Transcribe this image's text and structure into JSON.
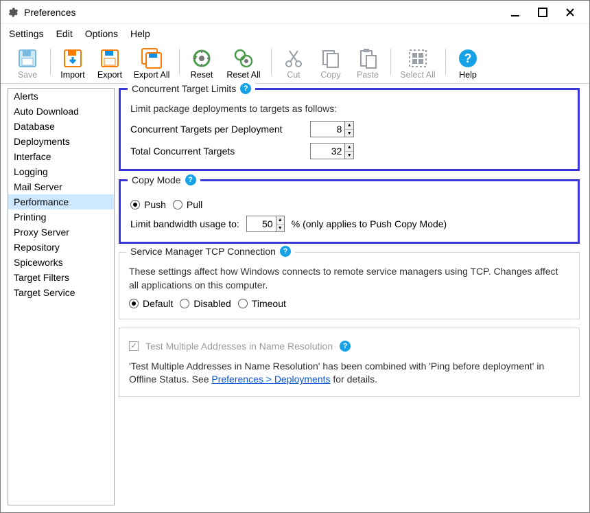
{
  "window": {
    "title": "Preferences"
  },
  "menu": {
    "settings": "Settings",
    "edit": "Edit",
    "options": "Options",
    "help": "Help"
  },
  "toolbar": {
    "save": "Save",
    "import": "Import",
    "export": "Export",
    "export_all": "Export All",
    "reset": "Reset",
    "reset_all": "Reset All",
    "cut": "Cut",
    "copy": "Copy",
    "paste": "Paste",
    "select_all": "Select All",
    "help": "Help"
  },
  "sidebar": {
    "items": [
      "Alerts",
      "Auto Download",
      "Database",
      "Deployments",
      "Interface",
      "Logging",
      "Mail Server",
      "Performance",
      "Printing",
      "Proxy Server",
      "Repository",
      "Spiceworks",
      "Target Filters",
      "Target Service"
    ],
    "selected_index": 7
  },
  "groups": {
    "concurrent": {
      "legend": "Concurrent Target Limits",
      "desc": "Limit package deployments to targets as follows:",
      "per_deploy_label": "Concurrent Targets per Deployment",
      "per_deploy_value": "8",
      "total_label": "Total Concurrent Targets",
      "total_value": "32"
    },
    "copy_mode": {
      "legend": "Copy Mode",
      "push": "Push",
      "pull": "Pull",
      "limit_prefix": "Limit bandwidth usage to:",
      "limit_value": "50",
      "limit_suffix": "% (only applies to Push Copy Mode)"
    },
    "svc": {
      "legend": "Service Manager TCP Connection",
      "desc": "These settings affect how Windows connects to remote service managers using TCP. Changes affect all applications on this computer.",
      "default": "Default",
      "disabled": "Disabled",
      "timeout": "Timeout"
    },
    "name_res": {
      "checkbox_label": "Test Multiple Addresses in Name Resolution",
      "note_prefix": "'Test Multiple Addresses in Name Resolution' has been combined with 'Ping before deployment' in Offline Status. See ",
      "note_link": "Preferences > Deployments",
      "note_suffix": " for details."
    }
  }
}
